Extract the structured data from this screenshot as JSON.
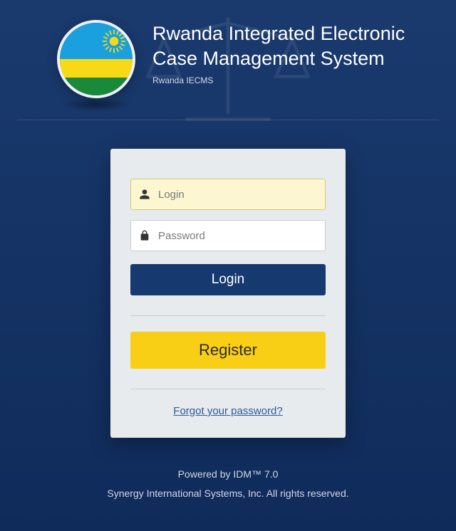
{
  "header": {
    "title": "Rwanda Integrated Electronic Case Management System",
    "subtitle": "Rwanda IECMS"
  },
  "form": {
    "login_placeholder": "Login",
    "password_placeholder": "Password",
    "login_button": "Login",
    "register_button": "Register",
    "forgot_link": "Forgot your password?"
  },
  "footer": {
    "powered": "Powered by IDM™ 7.0",
    "copyright": "Synergy International Systems, Inc. All rights reserved."
  }
}
